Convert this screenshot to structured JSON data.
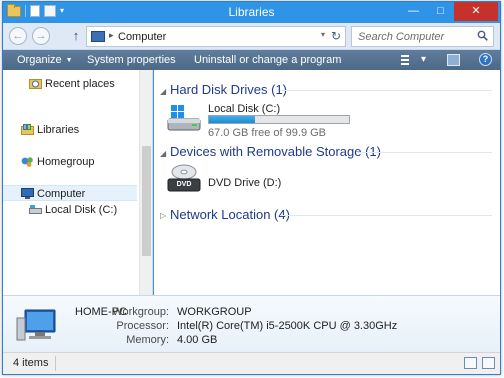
{
  "window": {
    "title": "Libraries",
    "buttons": {
      "minimize": "—",
      "maximize": "□",
      "close": "✕"
    },
    "accent": "#2f94e6"
  },
  "address": {
    "back": "←",
    "forward": "→",
    "up": "↑",
    "chevron": "▸",
    "path": "Computer",
    "dropdown": "▾",
    "refresh": "↻",
    "search_placeholder": "Search Computer"
  },
  "commands": {
    "organize": "Organize",
    "organize_caret": "▼",
    "system_properties": "System properties",
    "uninstall": "Uninstall or change a program",
    "view_dd": "▾",
    "help": "?"
  },
  "nav": {
    "items": [
      {
        "label": "Recent places",
        "icon": "recent-places-icon"
      },
      {
        "label": "Libraries",
        "icon": "libraries-icon"
      },
      {
        "label": "Homegroup",
        "icon": "homegroup-icon"
      },
      {
        "label": "Computer",
        "icon": "computer-icon",
        "selected": true
      },
      {
        "label": "Local Disk (C:)",
        "icon": "drive-icon"
      }
    ]
  },
  "content": {
    "groups": [
      {
        "label": "Hard Disk Drives (1)",
        "expanded": true
      },
      {
        "label": "Devices with Removable Storage (1)",
        "expanded": true
      },
      {
        "label": "Network Location (4)",
        "expanded": false
      }
    ],
    "drives": [
      {
        "name": "Local Disk (C:)",
        "free_text": "67.0 GB free of 99.9 GB",
        "used_fraction": 0.33
      },
      {
        "name": "DVD Drive (D:)"
      }
    ],
    "dvd_badge": "DVD",
    "expanded_glyph": "◢",
    "collapsed_glyph": "▷"
  },
  "details": {
    "pc_name": "HOME-PC",
    "workgroup_label": "Workgroup:",
    "workgroup_value": "WORKGROUP",
    "processor_label": "Processor:",
    "processor_value": "Intel(R) Core(TM) i5-2500K CPU @ 3.30GHz",
    "memory_label": "Memory:",
    "memory_value": "4.00 GB"
  },
  "status": {
    "items_count": "4 items"
  }
}
